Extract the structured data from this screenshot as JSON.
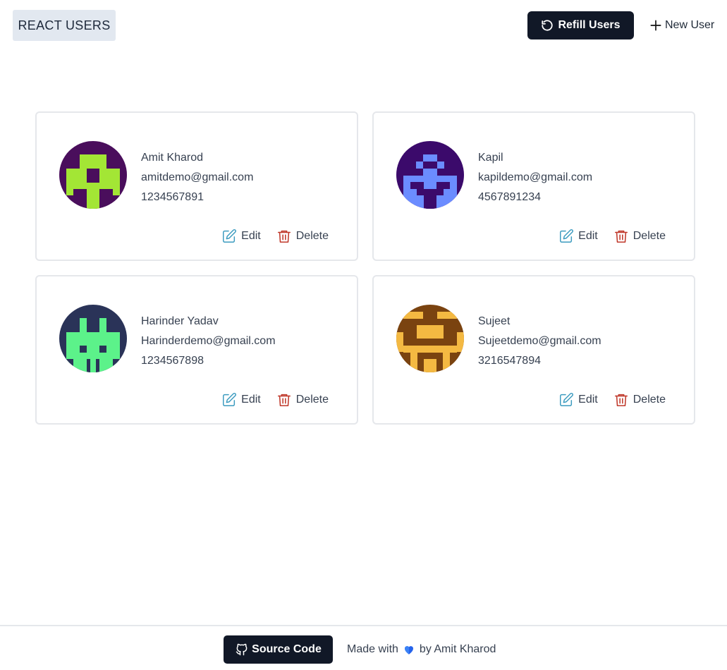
{
  "header": {
    "brand": "REACT USERS",
    "refill_label": "Refill Users",
    "new_user_label": "New User"
  },
  "users": [
    {
      "name": "Amit Kharod",
      "email": "amitdemo@gmail.com",
      "phone": "1234567891",
      "edit_label": "Edit",
      "delete_label": "Delete"
    },
    {
      "name": "Kapil",
      "email": "kapildemo@gmail.com",
      "phone": "4567891234",
      "edit_label": "Edit",
      "delete_label": "Delete"
    },
    {
      "name": "Harinder Yadav",
      "email": "Harinderdemo@gmail.com",
      "phone": "1234567898",
      "edit_label": "Edit",
      "delete_label": "Delete"
    },
    {
      "name": "Sujeet",
      "email": "Sujeetdemo@gmail.com",
      "phone": "3216547894",
      "edit_label": "Edit",
      "delete_label": "Delete"
    }
  ],
  "footer": {
    "source_label": "Source Code",
    "made_with": "Made with",
    "by": "by Amit Kharod"
  },
  "colors": {
    "dark_button": "#111827",
    "edit_icon": "#3b9bbf",
    "delete_icon": "#c0392b",
    "heart": "#2563eb"
  },
  "icons": [
    "refresh-icon",
    "plus-icon",
    "edit-icon",
    "trash-icon",
    "github-icon",
    "heart-icon"
  ]
}
